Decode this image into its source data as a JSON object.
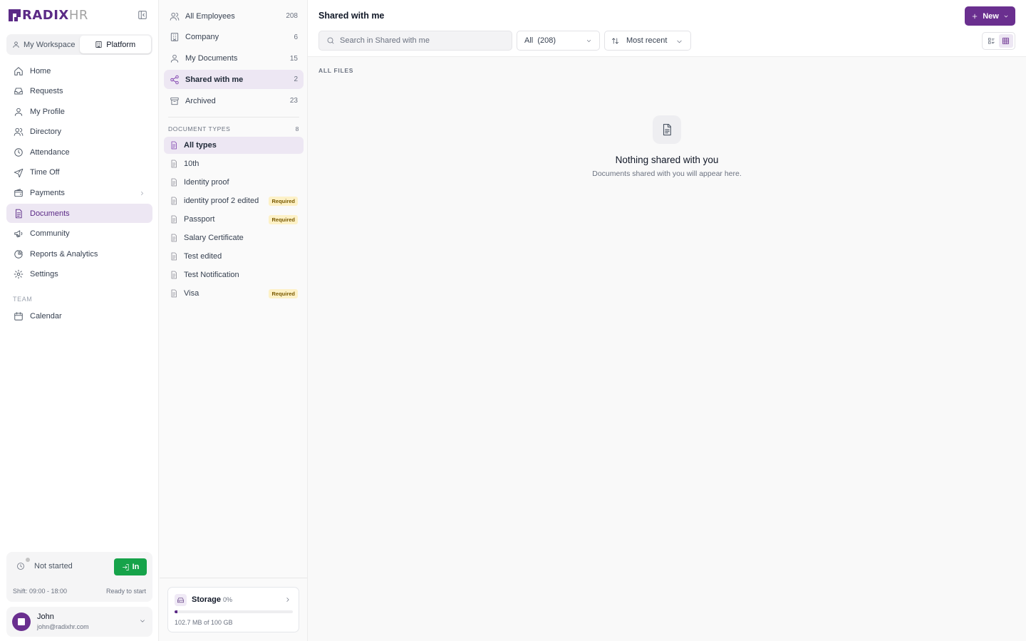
{
  "brand": {
    "logo_main": "RADIX",
    "logo_accent": "HR"
  },
  "workspace": {
    "tabs": [
      {
        "label": "My Workspace"
      },
      {
        "label": "Platform"
      }
    ]
  },
  "nav": {
    "items": [
      {
        "label": "Home",
        "icon": "home-icon"
      },
      {
        "label": "Requests",
        "icon": "inbox-icon"
      },
      {
        "label": "My Profile",
        "icon": "user-icon"
      },
      {
        "label": "Directory",
        "icon": "users-icon"
      },
      {
        "label": "Attendance",
        "icon": "clock-icon"
      },
      {
        "label": "Time Off",
        "icon": "plane-icon"
      },
      {
        "label": "Payments",
        "icon": "wallet-icon"
      },
      {
        "label": "Documents",
        "icon": "document-icon"
      },
      {
        "label": "Community",
        "icon": "megaphone-icon"
      },
      {
        "label": "Reports & Analytics",
        "icon": "pie-chart-icon"
      },
      {
        "label": "Settings",
        "icon": "gear-icon"
      }
    ],
    "team_label": "TEAM",
    "team_items": [
      {
        "label": "Calendar",
        "icon": "calendar-icon"
      }
    ]
  },
  "clock": {
    "status": "Not started",
    "button": "In",
    "shift": "Shift: 09:00 - 18:00",
    "ready": "Ready to start"
  },
  "user": {
    "name": "John",
    "email": "john@radixhr.com"
  },
  "folders": [
    {
      "label": "All Employees",
      "count": "208",
      "icon": "users-icon"
    },
    {
      "label": "Company",
      "count": "6",
      "icon": "building-icon"
    },
    {
      "label": "My Documents",
      "count": "15",
      "icon": "user-icon"
    },
    {
      "label": "Shared with me",
      "count": "2",
      "icon": "share-icon"
    },
    {
      "label": "Archived",
      "count": "23",
      "icon": "archive-icon"
    }
  ],
  "types": {
    "header": "DOCUMENT TYPES",
    "count": "8",
    "items": [
      {
        "label": "All types",
        "badge": ""
      },
      {
        "label": "10th",
        "badge": ""
      },
      {
        "label": "Identity proof",
        "badge": ""
      },
      {
        "label": "identity proof 2 edited",
        "badge": "Required"
      },
      {
        "label": "Passport",
        "badge": "Required"
      },
      {
        "label": "Salary Certificate",
        "badge": ""
      },
      {
        "label": "Test edited",
        "badge": ""
      },
      {
        "label": "Test Notification",
        "badge": ""
      },
      {
        "label": "Visa",
        "badge": "Required"
      }
    ]
  },
  "storage": {
    "title": "Storage",
    "percent_label": "0%",
    "used_fraction": 0.001,
    "usage": "102.7 MB of 100 GB"
  },
  "main": {
    "title": "Shared with me",
    "new_label": "New",
    "search_placeholder": "Search in Shared with me",
    "filter_label": "All",
    "filter_count": "(208)",
    "sort_label": "Most recent",
    "section_label": "ALL FILES",
    "empty_title": "Nothing shared with you",
    "empty_subtitle": "Documents shared with you will appear here."
  },
  "colors": {
    "brand": "#6a2f8f",
    "active_bg": "#ede7f3",
    "in_button": "#16a34a",
    "required_badge": "#fdf1c7"
  }
}
